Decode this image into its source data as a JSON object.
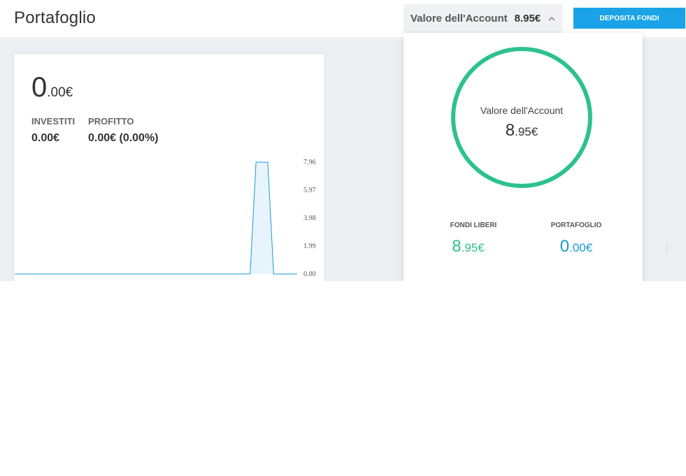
{
  "header": {
    "title": "Portafoglio",
    "account_label": "Valore dell'Account",
    "account_value": "8.95€",
    "deposit_label": "DEPOSITA FONDI"
  },
  "portfolio": {
    "total_int": "0",
    "total_dec": ".00€",
    "invested_label": "INVESTITI",
    "invested_value": "0.00€",
    "profit_label": "PROFITTO",
    "profit_value": "0.00€ (0.00%)"
  },
  "chart_data": {
    "type": "area",
    "y_ticks": [
      "7.96",
      "5.97",
      "3.98",
      "1.99",
      "0.00"
    ],
    "ylim": [
      0,
      7.96
    ],
    "values": [
      0,
      0,
      0,
      0,
      0,
      0,
      0,
      0,
      0,
      0,
      0,
      0,
      0,
      0,
      0,
      0,
      0,
      0,
      0,
      0,
      0,
      0,
      0,
      0,
      0,
      0,
      0,
      0,
      0,
      0,
      0,
      0,
      0,
      0,
      0,
      0,
      0,
      0,
      0,
      0,
      0,
      7.96,
      7.96,
      7.96,
      0,
      0,
      0,
      0,
      0
    ],
    "color": "#1a9ad6",
    "fill": "#e8f4fb"
  },
  "dropdown": {
    "ring_label": "Valore dell'Account",
    "ring_int": "8",
    "ring_dec": ".95€",
    "free_label": "FONDI LIBERI",
    "free_int": "8",
    "free_dec": ".95€",
    "portfolio_label": "PORTAFOGLIO",
    "portfolio_int": "0",
    "portfolio_dec": ".00€",
    "ring_color": "#2ec190"
  }
}
